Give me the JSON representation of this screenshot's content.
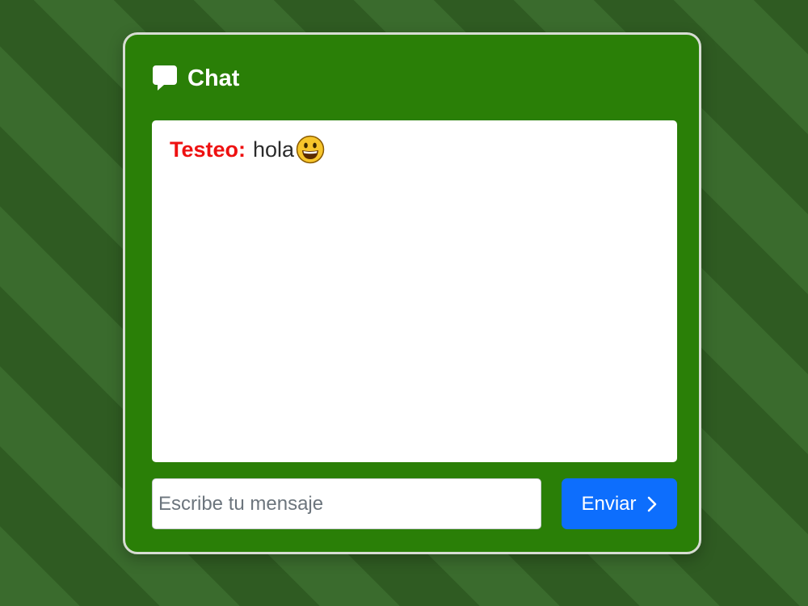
{
  "header": {
    "title": "Chat",
    "icon": "speech-bubble-icon"
  },
  "messages": [
    {
      "author": "Testeo:",
      "text": "hola",
      "emoji": "grinning-face"
    }
  ],
  "composer": {
    "placeholder": "Escribe tu mensaje",
    "value": "",
    "send_label": "Enviar",
    "send_icon": "chevron-right-icon"
  },
  "colors": {
    "card_background": "#2a7f07",
    "author_name": "#ee1111",
    "send_button": "#0d6efd",
    "page_stripes": [
      "#3a6b2d",
      "#2f5b22"
    ]
  }
}
